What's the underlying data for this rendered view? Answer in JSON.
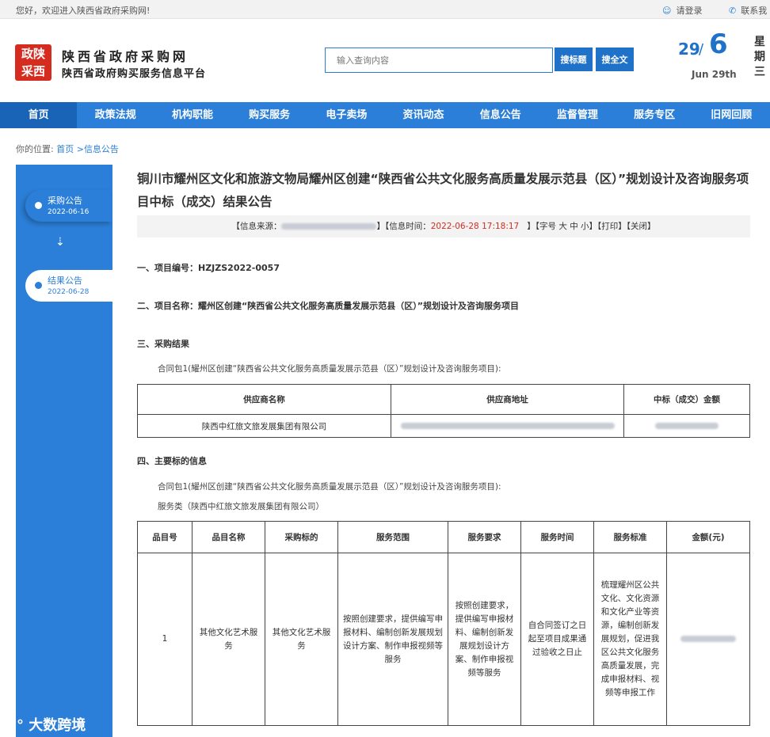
{
  "topbar": {
    "welcome": "您好，欢迎进入陕西省政府采购网!",
    "login": "请登录",
    "contact": "联系我"
  },
  "header": {
    "logo_text_1": "政陕",
    "logo_text_2": "采西",
    "site_name": "陕西省政府采购网",
    "site_subtitle": "陕西省政府购买服务信息平台",
    "search_placeholder": "输入查询内容",
    "btn_search_title": "搜标题",
    "btn_search_full": "搜全文",
    "date_day": "29",
    "date_slash": "/",
    "date_month": "6",
    "date_en": "Jun 29th",
    "weekday": "星期三"
  },
  "nav": [
    "首页",
    "政策法规",
    "机构职能",
    "购买服务",
    "电子卖场",
    "资讯动态",
    "信息公告",
    "监督管理",
    "服务专区",
    "旧网回顾"
  ],
  "breadcrumb": {
    "prefix": "你的位置:",
    "home": "首页",
    "sep": " >",
    "current": "信息公告"
  },
  "sidebar": {
    "steps": [
      {
        "title": "采购公告",
        "date": "2022-06-16"
      },
      {
        "title": "结果公告",
        "date": "2022-06-28"
      }
    ],
    "arrow": "⇣",
    "watermark": "大数跨境"
  },
  "article": {
    "title": "铜川市耀州区文化和旅游文物局耀州区创建“陕西省公共文化服务高质量发展示范县（区）”规划设计及咨询服务项目中标（成交）结果公告",
    "info_source_label": "【信息来源：",
    "info_time_label": "】【信息时间：",
    "info_time": "2022-06-28 17:18:17",
    "info_font": "】【字号 大 中 小】【打印】【关闭】",
    "sec1": "一、项目编号：HZJZS2022-0057",
    "sec2": "二、项目名称：耀州区创建“陕西省公共文化服务高质量发展示范县（区）”规划设计及咨询服务项目",
    "sec3": "三、采购结果",
    "sec3_contract": "合同包1(耀州区创建“陕西省公共文化服务高质量发展示范县（区）”规划设计及咨询服务项目):",
    "table1": {
      "headers": [
        "供应商名称",
        "供应商地址",
        "中标（成交）金额"
      ],
      "row": [
        "陕西中红旅文旅发展集团有限公司"
      ]
    },
    "sec4": "四、主要标的信息",
    "sec4_contract": "合同包1(耀州区创建“陕西省公共文化服务高质量发展示范县（区）”规划设计及咨询服务项目):",
    "sec4_service": "服务类（陕西中红旅文旅发展集团有限公司）",
    "table2": {
      "headers": [
        "品目号",
        "品目名称",
        "采购标的",
        "服务范围",
        "服务要求",
        "服务时间",
        "服务标准",
        "金额(元)"
      ],
      "row": [
        "1",
        "其他文化艺术服务",
        "其他文化艺术服务",
        "按照创建要求，提供编写申报材料、编制创新发展规划设计方案、制作申报视频等服务",
        "按照创建要求，提供编写申报材料、编制创新发展规划设计方案、制作申报视频等服务",
        "自合同签订之日起至项目成果通过验收之日止",
        "梳理耀州区公共文化、文化资源和文化产业等资源，编制创新发展规划，促进我区公共文化服务高质量发展，完成申报材料、视频等申报工作"
      ]
    }
  }
}
